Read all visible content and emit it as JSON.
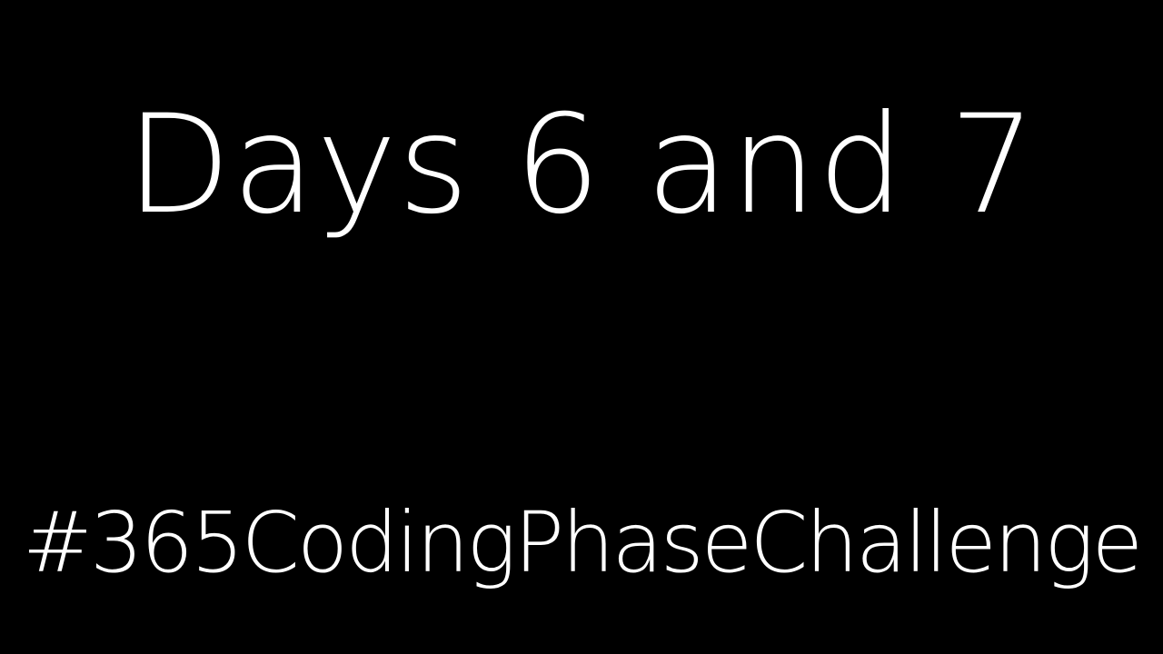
{
  "slide": {
    "title": "Days 6 and 7",
    "hashtag": "#365CodingPhaseChallenge"
  },
  "colors": {
    "background": "#000000",
    "text": "#ffffff"
  }
}
